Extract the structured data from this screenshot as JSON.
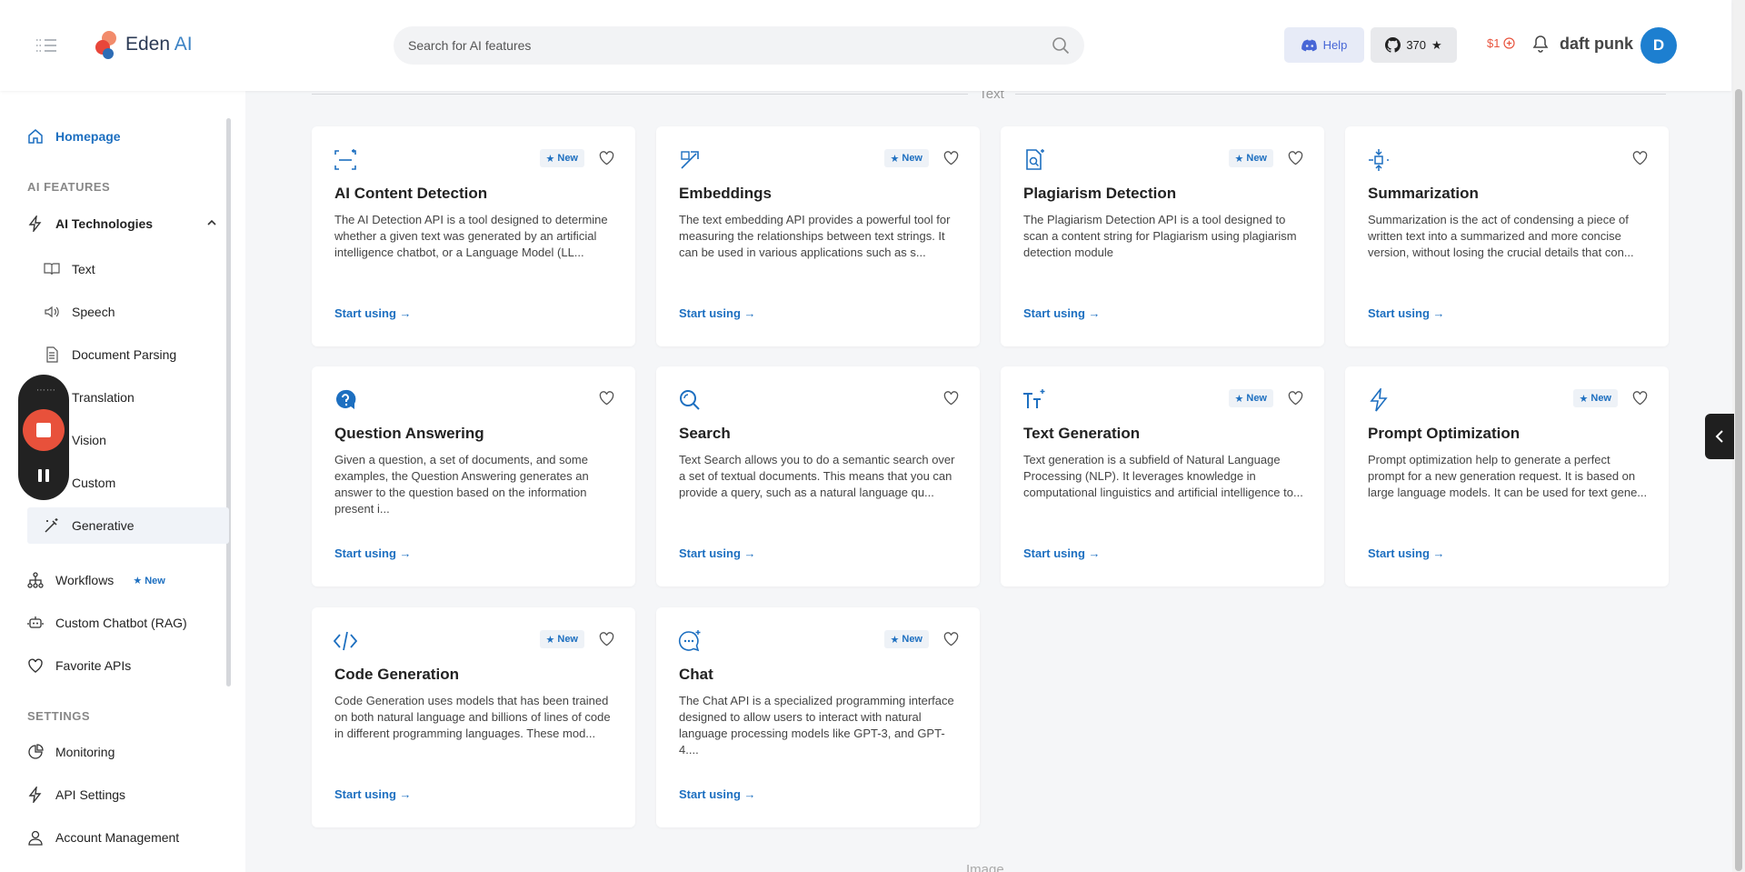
{
  "header": {
    "logo_name": "Eden",
    "logo_ai": "AI",
    "search_placeholder": "Search for AI features",
    "help_label": "Help",
    "github_stars": "370",
    "credit": "$1",
    "username": "daft punk",
    "avatar_initial": "D"
  },
  "sidebar": {
    "homepage": "Homepage",
    "section_features": "AI FEATURES",
    "ai_technologies": "AI Technologies",
    "subitems": [
      "Text",
      "Speech",
      "Document Parsing",
      "Translation",
      "Vision",
      "Custom",
      "Generative"
    ],
    "workflows": "Workflows",
    "workflows_badge": "New",
    "chatbot": "Custom Chatbot (RAG)",
    "favorites": "Favorite APIs",
    "section_settings": "SETTINGS",
    "monitoring": "Monitoring",
    "api_settings": "API Settings",
    "account": "Account Management"
  },
  "main": {
    "section_text": "Text",
    "section_image": "Image",
    "cta": "Start using →",
    "badge": "New",
    "cards": [
      {
        "title": "AI Content Detection",
        "desc": "The AI Detection API is a tool designed to determine whether a given text was generated by an artificial intelligence chatbot, or a Language Model (LL...",
        "new": true,
        "icon": "scan-sparkle-icon"
      },
      {
        "title": "Embeddings",
        "desc": "The text embedding API provides a powerful tool for measuring the relationships between text strings. It can be used in various applications such as s...",
        "new": true,
        "icon": "vector-icon"
      },
      {
        "title": "Plagiarism Detection",
        "desc": "The Plagiarism Detection API is a tool designed to scan a content string for Plagiarism using plagiarism detection module",
        "new": true,
        "icon": "document-search-icon"
      },
      {
        "title": "Summarization",
        "desc": "Summarization is the act of condensing a piece of written text into a summarized and more concise version, without losing the crucial details that con...",
        "new": false,
        "icon": "compress-icon"
      },
      {
        "title": "Question Answering",
        "desc": "Given a question, a set of documents, and some examples, the Question Answering generates an answer to the question based on the information present i...",
        "new": false,
        "icon": "question-bubble-icon"
      },
      {
        "title": "Search",
        "desc": "Text Search allows you to do a semantic search over a set of textual documents. This means that you can provide a query, such as a natural language qu...",
        "new": false,
        "icon": "search-icon"
      },
      {
        "title": "Text Generation",
        "desc": "Text generation is a subfield of Natural Language Processing (NLP). It leverages knowledge in computational linguistics and artificial intelligence to...",
        "new": true,
        "icon": "text-sparkle-icon"
      },
      {
        "title": "Prompt Optimization",
        "desc": "Prompt optimization help to generate a perfect prompt for a new generation request. It is based on large language models. It can be used for text gene...",
        "new": true,
        "icon": "bolt-icon"
      },
      {
        "title": "Code Generation",
        "desc": "Code Generation uses models that has been trained on both natural language and billions of lines of code in different programming languages. These mod...",
        "new": true,
        "icon": "code-icon"
      },
      {
        "title": "Chat",
        "desc": "The Chat API is a specialized programming interface designed to allow users to interact with natural language processing models like GPT-3, and GPT-4....",
        "new": true,
        "icon": "chat-sparkle-icon"
      }
    ]
  }
}
